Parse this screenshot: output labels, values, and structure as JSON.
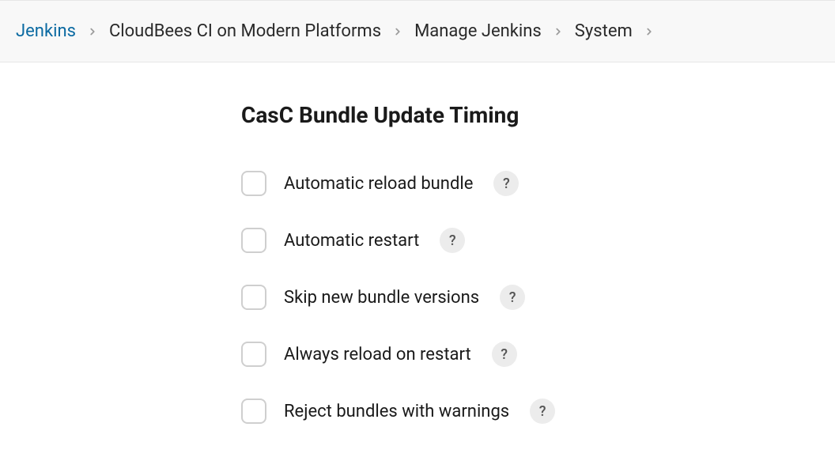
{
  "breadcrumb": {
    "items": [
      {
        "label": "Jenkins"
      },
      {
        "label": "CloudBees CI on Modern Platforms"
      },
      {
        "label": "Manage Jenkins"
      },
      {
        "label": "System"
      }
    ]
  },
  "section": {
    "title": "CasC Bundle Update Timing",
    "help_symbol": "?",
    "options": [
      {
        "label": "Automatic reload bundle"
      },
      {
        "label": "Automatic restart"
      },
      {
        "label": "Skip new bundle versions"
      },
      {
        "label": "Always reload on restart"
      },
      {
        "label": "Reject bundles with warnings"
      }
    ]
  }
}
